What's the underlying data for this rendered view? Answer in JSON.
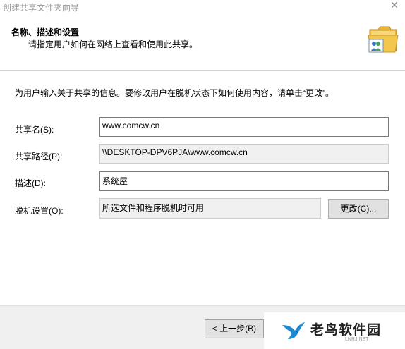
{
  "window": {
    "title": "创建共享文件夹向导",
    "close_glyph": "✕"
  },
  "header": {
    "title": "名称、描述和设置",
    "subtitle": "请指定用户如何在网络上查看和使用此共享。",
    "icon": "shared-folder-icon"
  },
  "body": {
    "intro": "为用户输入关于共享的信息。要修改用户在脱机状态下如何使用内容，请单击“更改”。",
    "share_name": {
      "label": "共享名(S):",
      "value": "www.comcw.cn"
    },
    "share_path": {
      "label": "共享路径(P):",
      "value": "\\\\DESKTOP-DPV6PJA\\www.comcw.cn"
    },
    "description": {
      "label": "描述(D):",
      "value": "系统屋"
    },
    "offline": {
      "label": "脱机设置(O):",
      "value": "所选文件和程序脱机时可用",
      "change_button": "更改(C)..."
    }
  },
  "footer": {
    "back_button": "< 上一步(B)"
  },
  "watermark": {
    "text": "老鸟软件园",
    "sub": "LNRJ.NET"
  },
  "colors": {
    "watermark_blue": "#1e88d0",
    "field_border": "#7a7a7a",
    "button_face": "#e1e1e1"
  }
}
